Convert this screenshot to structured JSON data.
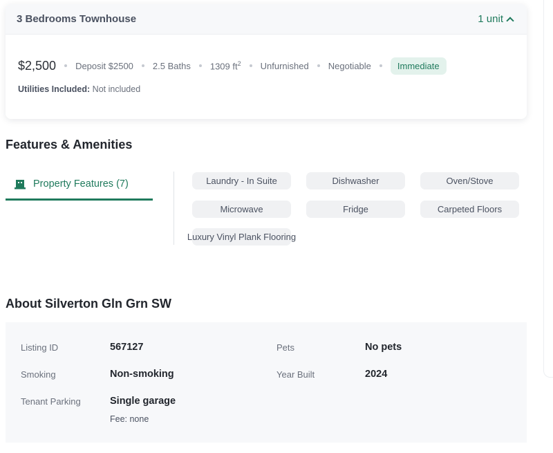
{
  "unit": {
    "title": "3 Bedrooms Townhouse",
    "unit_count": "1 unit",
    "price": "$2,500",
    "deposit": "Deposit $2500",
    "baths": "2.5 Baths",
    "area": "1309 ft",
    "area_exp": "2",
    "furnishing": "Unfurnished",
    "negotiable": "Negotiable",
    "availability": "Immediate",
    "utilities_label": "Utilities Included:",
    "utilities_value": "Not included"
  },
  "features": {
    "title": "Features & Amenities",
    "tab_label": "Property Features (7)",
    "items": [
      "Laundry - In Suite",
      "Dishwasher",
      "Oven/Stove",
      "Microwave",
      "Fridge",
      "Carpeted Floors",
      "Luxury Vinyl Plank Flooring"
    ]
  },
  "about": {
    "title": "About Silverton Gln Grn SW",
    "listing_id_label": "Listing ID",
    "listing_id": "567127",
    "pets_label": "Pets",
    "pets": "No pets",
    "smoking_label": "Smoking",
    "smoking": "Non-smoking",
    "year_built_label": "Year Built",
    "year_built": "2024",
    "parking_label": "Tenant Parking",
    "parking": "Single garage",
    "parking_fee": "Fee: none"
  },
  "colors": {
    "accent": "#1f7a5c",
    "badge_bg": "#e3f2ec",
    "chip_bg": "#f0f1f3"
  },
  "icons": {
    "collapse": "chevron-up-icon",
    "features_tab": "building-icon"
  }
}
